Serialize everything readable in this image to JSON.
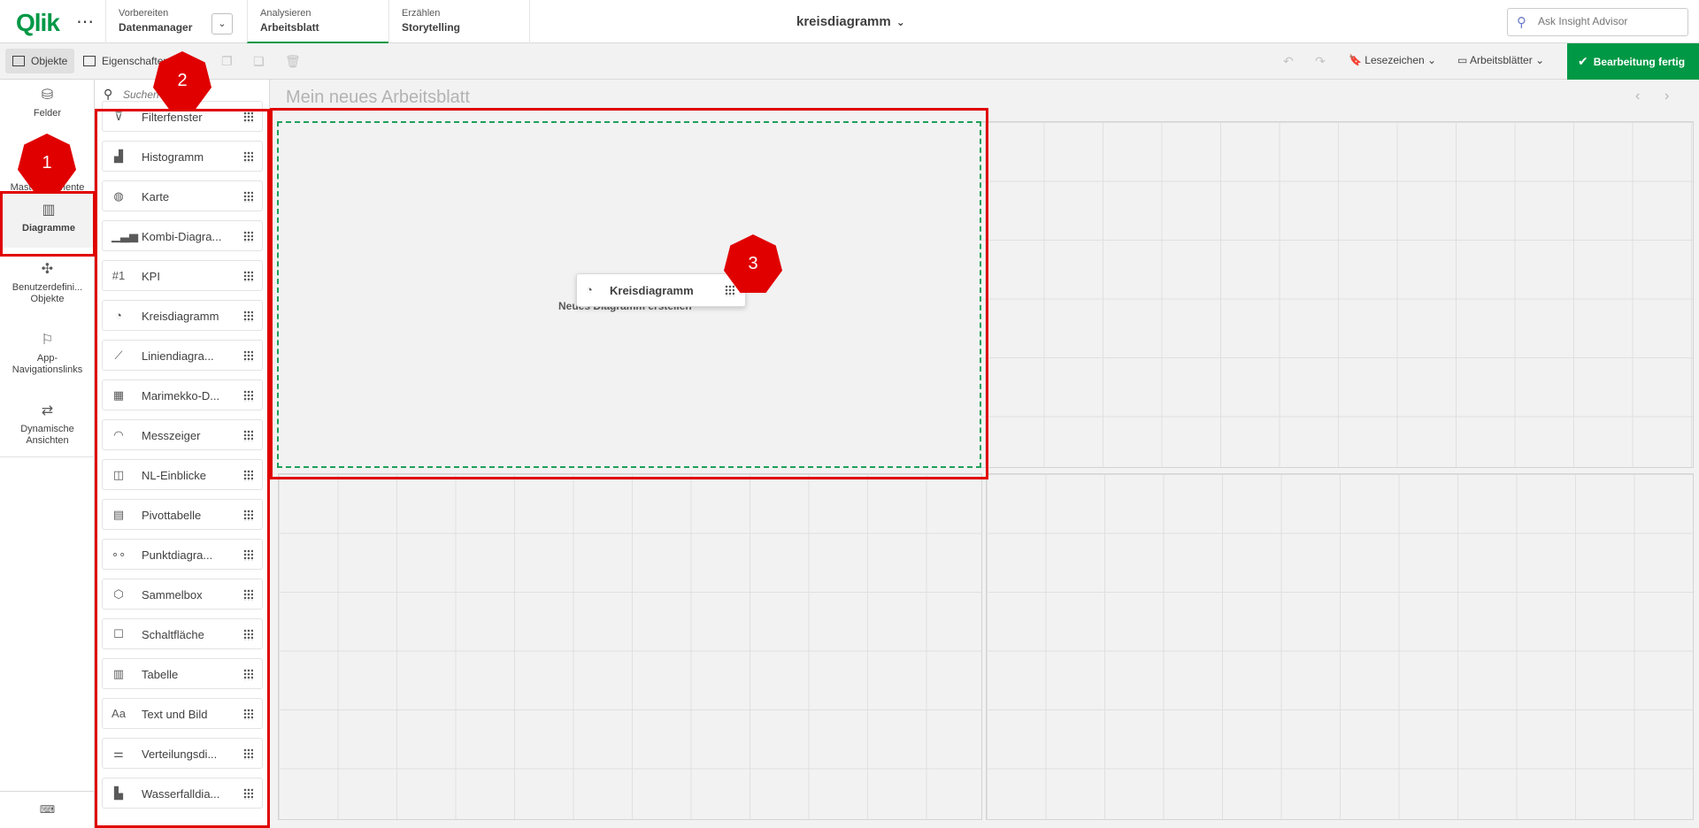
{
  "topbar": {
    "logo": "Qlik",
    "tabs": [
      {
        "small": "Vorbereiten",
        "big": "Datenmanager"
      },
      {
        "small": "Analysieren",
        "big": "Arbeitsblatt"
      },
      {
        "small": "Erzählen",
        "big": "Storytelling"
      }
    ],
    "app_title": "kreisdiagramm",
    "search_placeholder": "Ask Insight Advisor"
  },
  "toolbar": {
    "objects_label": "Objekte",
    "properties_label": "Eigenschaften",
    "bookmarks_label": "Lesezeichen",
    "sheets_label": "Arbeitsblätter",
    "done_label": "Bearbeitung fertig"
  },
  "sidebar": {
    "items": [
      {
        "label": "Felder",
        "icon": "database-icon"
      },
      {
        "label": "Master-Elemente",
        "icon": "link-icon"
      },
      {
        "label": "Diagramme",
        "icon": "bar-chart-icon"
      },
      {
        "label": "Benutzerdefini... Objekte",
        "icon": "puzzle-icon"
      },
      {
        "label": "App-Navigationslinks",
        "icon": "signpost-icon"
      },
      {
        "label": "Dynamische Ansichten",
        "icon": "refresh-icon"
      }
    ],
    "bottom_icon": "script-icon"
  },
  "panel": {
    "search_placeholder": "Suchen",
    "charts": [
      {
        "label": "Filterfenster",
        "icon": "filter-icon",
        "glyph": "⊽"
      },
      {
        "label": "Histogramm",
        "icon": "histogram-icon",
        "glyph": "▟"
      },
      {
        "label": "Karte",
        "icon": "globe-icon",
        "glyph": "◍"
      },
      {
        "label": "Kombi-Diagra...",
        "icon": "combo-chart-icon",
        "glyph": "▁▃▅"
      },
      {
        "label": "KPI",
        "icon": "kpi-icon",
        "glyph": "#1"
      },
      {
        "label": "Kreisdiagramm",
        "icon": "pie-chart-icon",
        "glyph": "◔"
      },
      {
        "label": "Liniendiagra...",
        "icon": "line-chart-icon",
        "glyph": "⟋"
      },
      {
        "label": "Marimekko-D...",
        "icon": "marimekko-icon",
        "glyph": "▦"
      },
      {
        "label": "Messzeiger",
        "icon": "gauge-icon",
        "glyph": "◠"
      },
      {
        "label": "NL-Einblicke",
        "icon": "nl-insights-icon",
        "glyph": "◫"
      },
      {
        "label": "Pivottabelle",
        "icon": "pivot-table-icon",
        "glyph": "▤"
      },
      {
        "label": "Punktdiagra...",
        "icon": "scatter-icon",
        "glyph": "∘∘"
      },
      {
        "label": "Sammelbox",
        "icon": "container-icon",
        "glyph": "⬡"
      },
      {
        "label": "Schaltfläche",
        "icon": "button-icon",
        "glyph": "☐"
      },
      {
        "label": "Tabelle",
        "icon": "table-icon",
        "glyph": "▥"
      },
      {
        "label": "Text und Bild",
        "icon": "text-image-icon",
        "glyph": "Aa"
      },
      {
        "label": "Verteilungsdi...",
        "icon": "distribution-icon",
        "glyph": "⚌"
      },
      {
        "label": "Wasserfalldia...",
        "icon": "waterfall-icon",
        "glyph": "▙"
      }
    ]
  },
  "canvas": {
    "sheet_title": "Mein neues Arbeitsblatt",
    "dropzone_text": "Neues Diagramm erstellen",
    "drag_label": "Kreisdiagramm"
  },
  "annotations": [
    "1",
    "2",
    "3"
  ],
  "colors": {
    "accent": "#009845",
    "highlight": "#e00000"
  }
}
